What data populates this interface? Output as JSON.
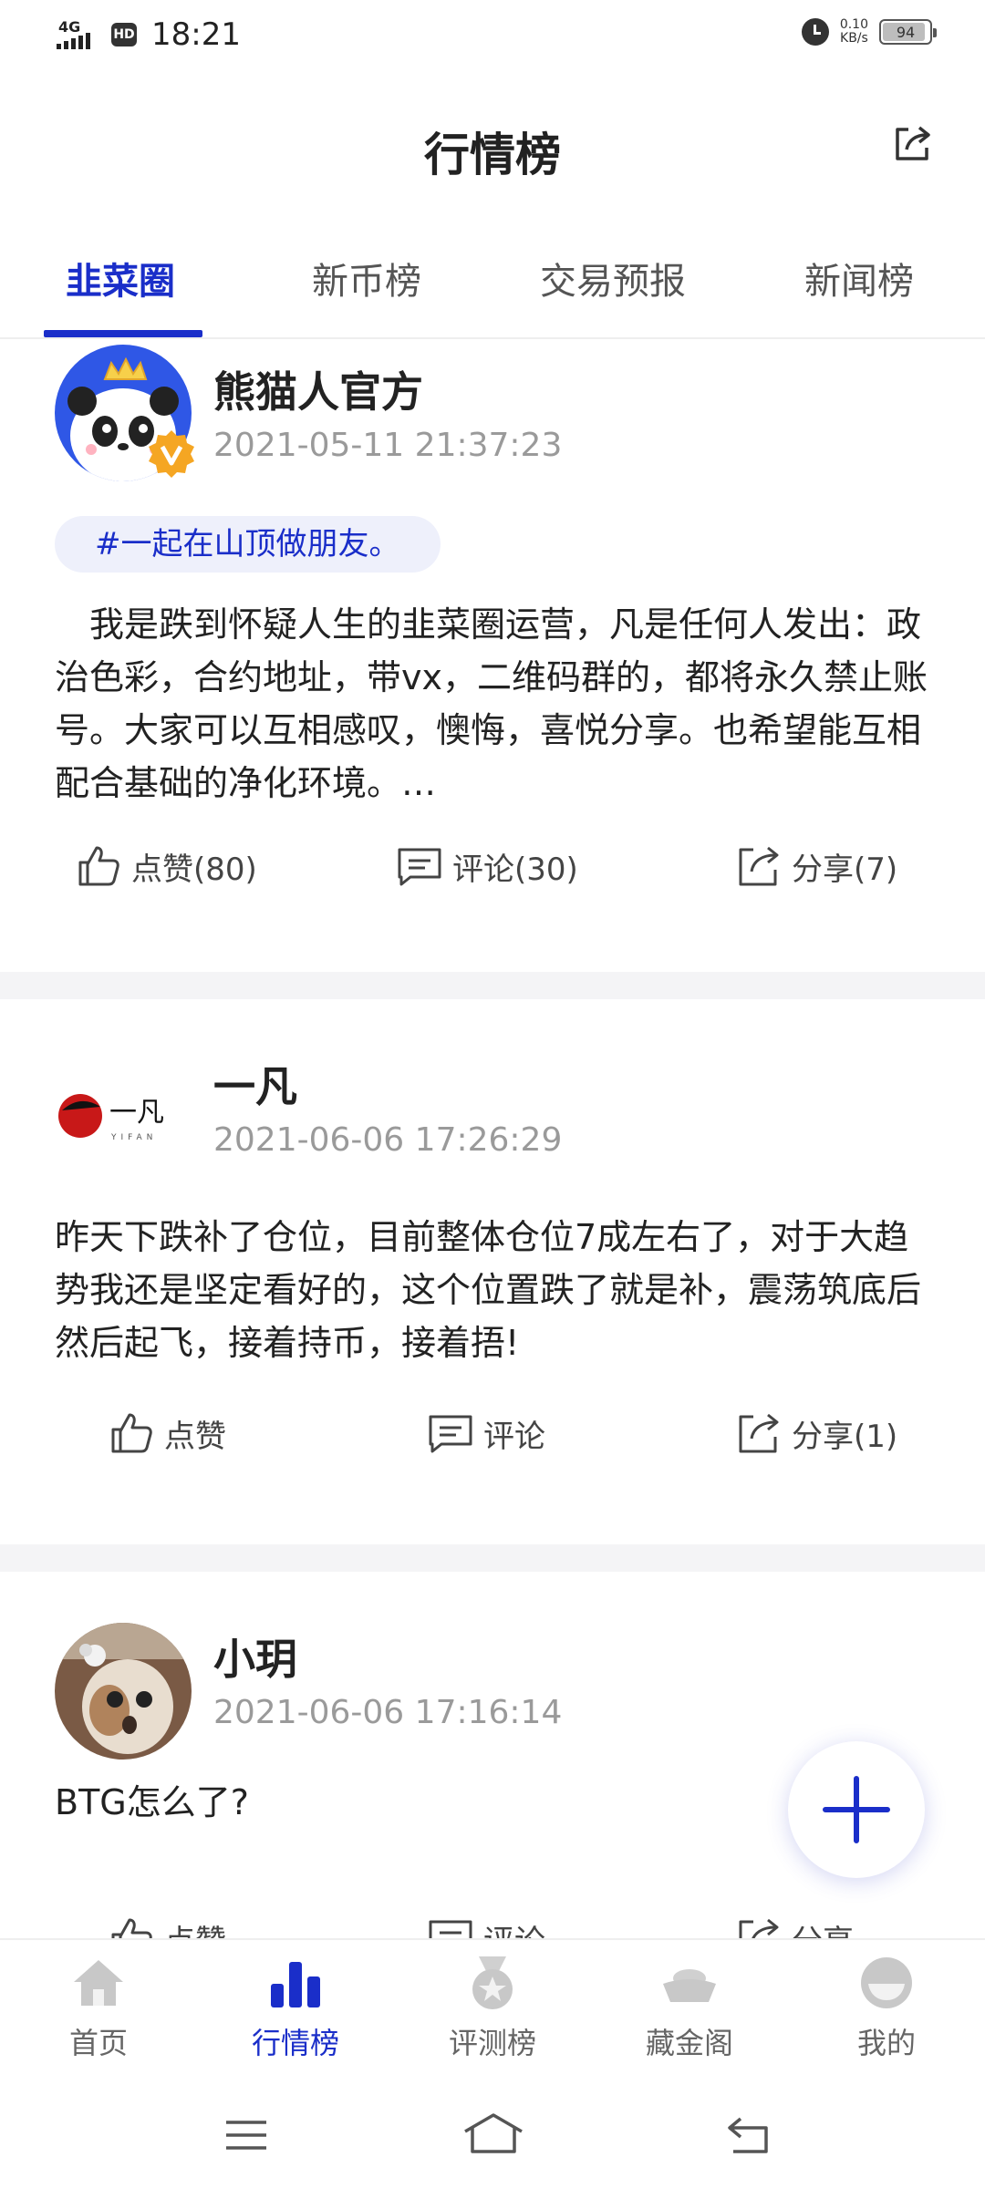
{
  "status_bar": {
    "network": "4G",
    "hd": "HD",
    "time": "18:21",
    "net_speed_value": "0.10",
    "net_speed_unit": "KB/s",
    "battery": "94"
  },
  "header": {
    "title": "行情榜"
  },
  "tabs": [
    {
      "label": "韭菜圈",
      "active": true
    },
    {
      "label": "新币榜",
      "active": false
    },
    {
      "label": "交易预报",
      "active": false
    },
    {
      "label": "新闻榜",
      "active": false
    }
  ],
  "posts": [
    {
      "author": "熊猫人官方",
      "time": "2021-05-11 21:37:23",
      "tag": "#一起在山顶做朋友。",
      "content": "我是跌到怀疑人生的韭菜圈运营，凡是任何人发出：政治色彩，合约地址，带vx，二维码群的，都将永久禁止账号。大家可以互相感叹，懊悔，喜悦分享。也希望能互相配合基础的净化环境。…",
      "like": "点赞(80)",
      "comment": "评论(30)",
      "share": "分享(7)"
    },
    {
      "author": "一凡",
      "avatar_text": "一凡",
      "avatar_sub": "YIFAN",
      "time": "2021-06-06 17:26:29",
      "content": "昨天下跌补了仓位，目前整体仓位7成左右了，对于大趋势我还是坚定看好的，这个位置跌了就是补，震荡筑底后然后起飞，接着持币，接着捂!",
      "like": "点赞",
      "comment": "评论",
      "share": "分享(1)"
    },
    {
      "author": "小玥",
      "time": "2021-06-06 17:16:14",
      "content": "BTG怎么了?",
      "like": "点赞",
      "comment": "评论",
      "share": "分享"
    }
  ],
  "bottom_nav": [
    {
      "label": "首页",
      "icon": "home-icon"
    },
    {
      "label": "行情榜",
      "icon": "chart-icon"
    },
    {
      "label": "评测榜",
      "icon": "medal-icon"
    },
    {
      "label": "藏金阁",
      "icon": "gold-ingot-icon"
    },
    {
      "label": "我的",
      "icon": "profile-icon"
    }
  ],
  "colors": {
    "accent": "#1a2ec9",
    "text": "#222222",
    "muted": "#9a9a9a",
    "tag_bg": "#eef0fb"
  }
}
